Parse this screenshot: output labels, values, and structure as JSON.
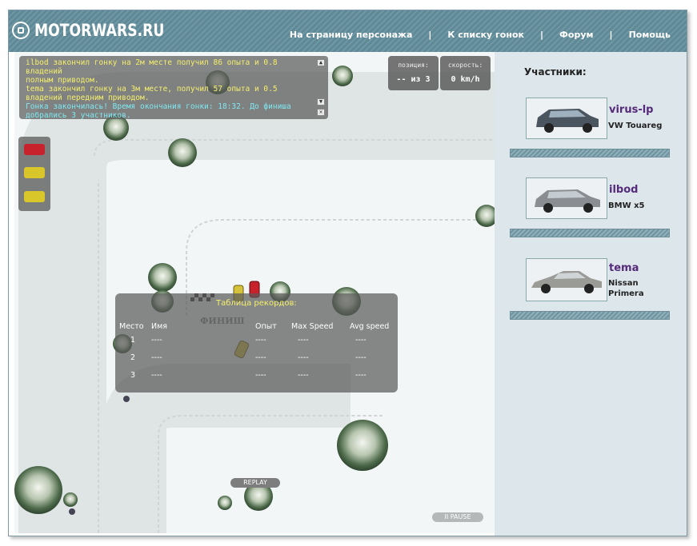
{
  "header": {
    "logo_text": "MOTORWARS.RU",
    "nav": [
      {
        "label": "На страницу персонажа"
      },
      {
        "label": "К списку гонок"
      },
      {
        "label": "Форум"
      },
      {
        "label": "Помощь"
      }
    ],
    "separator": "|"
  },
  "messages": {
    "line1": "ilbod закончил гонку на 2м месте получил 86 опыта и 0.8 владений",
    "line2": "полным приводом.",
    "line3": "tema закончил гонку на 3м месте, получил 57 опыта и 0.5",
    "line4": "владений передним приводом.",
    "line5": "Гонка закончилась! Время окончания гонки: 18:32. До финиша",
    "line6": "добрались 3 участников."
  },
  "position": {
    "label": "позиция:",
    "value": "-- из 3"
  },
  "speed": {
    "label": "скорость:",
    "value": "0 km/h"
  },
  "records": {
    "title": "Таблица рекордов:",
    "finish_sign": "ФИНИШ",
    "headers": {
      "place": "Место",
      "name": "Имя",
      "exp": "Опыт",
      "max_speed": "Max Speed",
      "avg_speed": "Avg speed"
    },
    "rows": [
      {
        "place": "1",
        "name": "----",
        "exp": "----",
        "max": "----",
        "avg": "----"
      },
      {
        "place": "2",
        "name": "----",
        "exp": "----",
        "max": "----",
        "avg": "----"
      },
      {
        "place": "3",
        "name": "----",
        "exp": "----",
        "max": "----",
        "avg": "----"
      }
    ]
  },
  "controls": {
    "replay": "REPLAY",
    "pause": "II PAUSE"
  },
  "sidebar": {
    "title": "Участники:",
    "players": [
      {
        "name": "virus-lp",
        "car_line1": "VW Touareg",
        "car_line2": ""
      },
      {
        "name": "ilbod",
        "car_line1": "BMW x5",
        "car_line2": ""
      },
      {
        "name": "tema",
        "car_line1": "Nissan",
        "car_line2": "Primera"
      }
    ]
  },
  "colors": {
    "header": "#6f97a4",
    "message_yellow": "#f5ef6b",
    "message_cyan": "#7fe8f0",
    "player_name": "#552a7a"
  }
}
